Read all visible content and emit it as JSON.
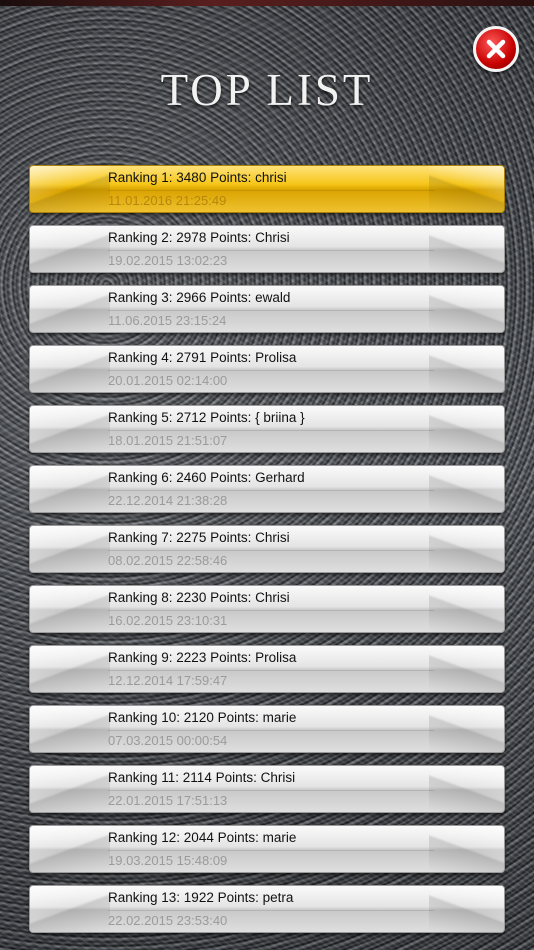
{
  "header": {
    "title": "TOP LIST",
    "close_icon": "close-x-icon",
    "close_color": "#d40000"
  },
  "colors": {
    "highlight_row": "#f5c518",
    "row": "#e4e4e4",
    "date_text": "#9b9b9b"
  },
  "rankings": [
    {
      "label": "Ranking 1: 3480 Points: chrisi",
      "date": "11.01.2016 21:25:49",
      "highlight": true
    },
    {
      "label": "Ranking 2: 2978 Points: Chrisi",
      "date": "19.02.2015 13:02:23",
      "highlight": false
    },
    {
      "label": "Ranking 3: 2966 Points: ewald",
      "date": "11.06.2015 23:15:24",
      "highlight": false
    },
    {
      "label": "Ranking 4: 2791 Points: Prolisa",
      "date": "20.01.2015 02:14:00",
      "highlight": false
    },
    {
      "label": "Ranking 5: 2712 Points: { briina }",
      "date": "18.01.2015 21:51:07",
      "highlight": false
    },
    {
      "label": "Ranking 6: 2460 Points: Gerhard",
      "date": "22.12.2014 21:38:28",
      "highlight": false
    },
    {
      "label": "Ranking 7: 2275 Points: Chrisi",
      "date": "08.02.2015 22:58:46",
      "highlight": false
    },
    {
      "label": "Ranking 8: 2230 Points: Chrisi",
      "date": "16.02.2015 23:10:31",
      "highlight": false
    },
    {
      "label": "Ranking 9: 2223 Points: Prolisa",
      "date": "12.12.2014 17:59:47",
      "highlight": false
    },
    {
      "label": "Ranking 10: 2120 Points: marie",
      "date": "07.03.2015 00:00:54",
      "highlight": false
    },
    {
      "label": "Ranking 11: 2114 Points: Chrisi",
      "date": "22.01.2015 17:51:13",
      "highlight": false
    },
    {
      "label": "Ranking 12: 2044 Points: marie",
      "date": "19.03.2015 15:48:09",
      "highlight": false
    },
    {
      "label": "Ranking 13: 1922 Points: petra",
      "date": "22.02.2015 23:53:40",
      "highlight": false
    }
  ]
}
